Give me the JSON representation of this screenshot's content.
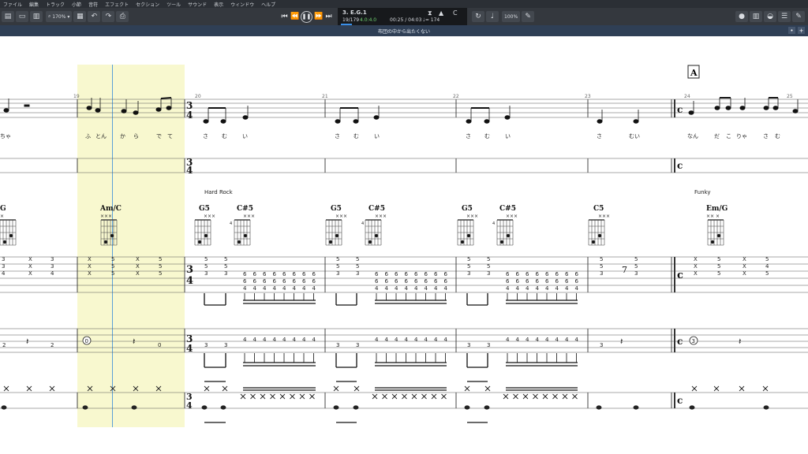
{
  "menu": [
    "ファイル",
    "編集",
    "トラック",
    "小節",
    "音符",
    "エフェクト",
    "セクション",
    "ツール",
    "サウンド",
    "表示",
    "ウィンドウ",
    "ヘルプ"
  ],
  "toolbar": {
    "zoom": "170%"
  },
  "transport": {
    "track_name": "3. E.G.1",
    "bar_position": "19/179",
    "time_signature": "4.0:4.0",
    "time": "00:25 / 04:03",
    "tempo": "♩= 174",
    "key": "C",
    "volume_label": "100%"
  },
  "title": "布団の中から出たくない",
  "colors": {
    "toolbar": "#34383e",
    "title_bar": "#2f3f55",
    "highlight": "#f8f8cf",
    "cursor": "#5aa0d8"
  },
  "score": {
    "bar_numbers": [
      "19",
      "20",
      "21",
      "22",
      "23",
      "24",
      "25"
    ],
    "section_marker": "A",
    "time_signature_top": "3",
    "time_signature_bottom": "4",
    "common_time": "c",
    "lyrics_left": "ちゃ",
    "lyrics": [
      [
        "ふ",
        "とん",
        "か",
        "ら",
        "で",
        "て"
      ],
      [
        "さ",
        "む",
        "い"
      ],
      [
        "さ",
        "む",
        "い"
      ],
      [
        "さ",
        "む",
        "い"
      ],
      [
        "さ",
        "むい"
      ],
      [
        "なん",
        "だ",
        "こ",
        "りゃ",
        "さ",
        "む"
      ]
    ],
    "style_labels": [
      "Hard Rock",
      "Funky"
    ],
    "chords": [
      "G",
      "Am/C",
      "G5",
      "C#5",
      "G5",
      "C#5",
      "G5",
      "C#5",
      "C5",
      "Em/G"
    ],
    "chord_muted": [
      "×",
      "×××",
      "×××",
      "×××",
      "×××",
      "×××",
      "×××",
      "×××",
      "×××",
      "×× ×"
    ],
    "fret_marker": "4",
    "bass_circles": [
      "0",
      "3"
    ]
  }
}
